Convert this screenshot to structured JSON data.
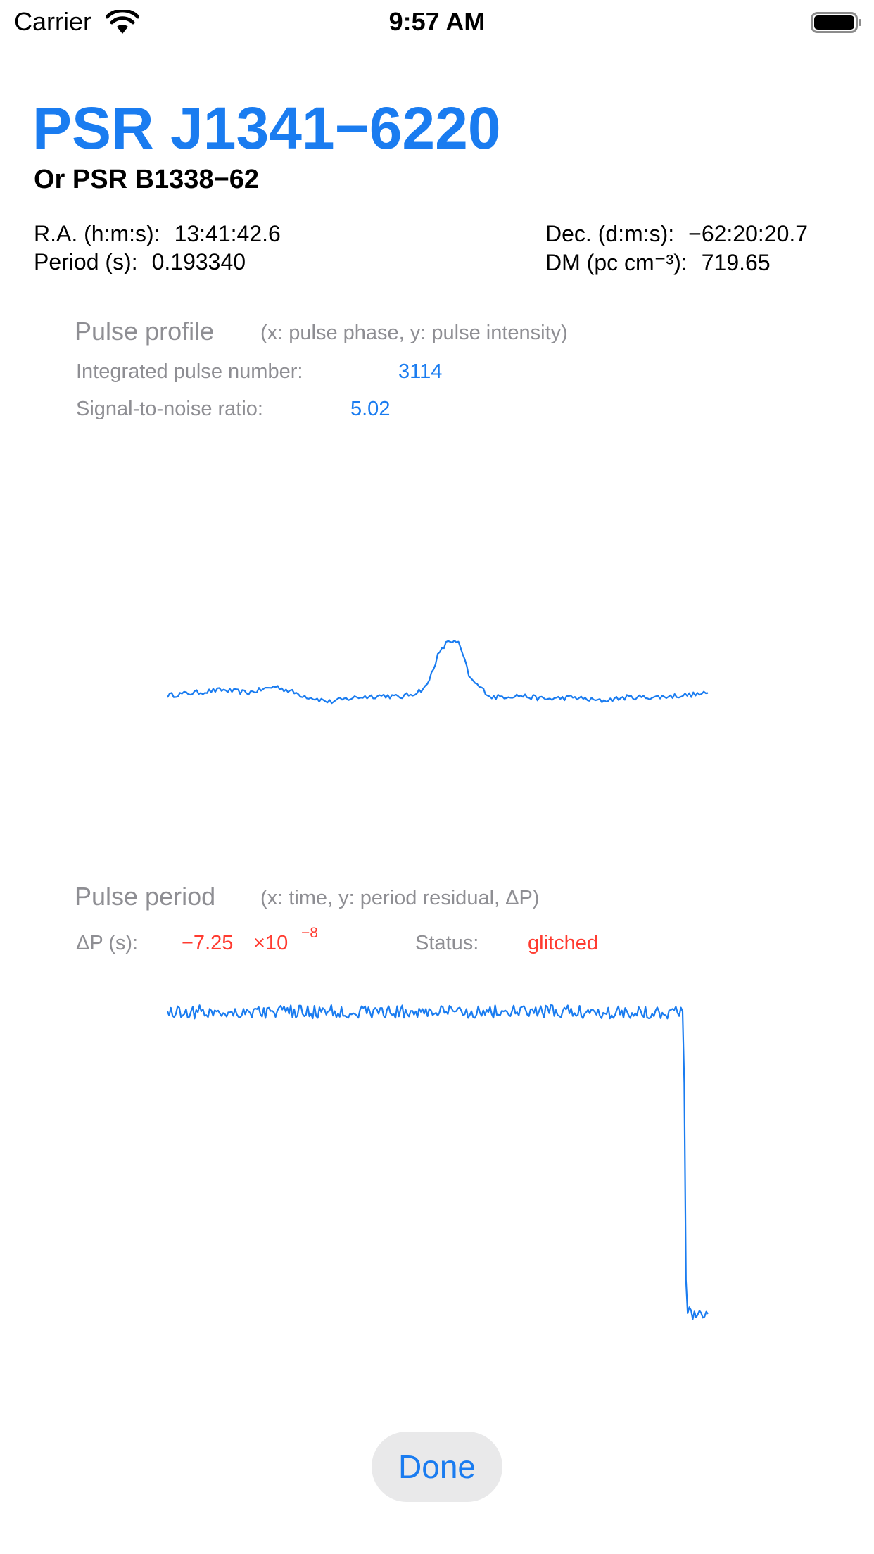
{
  "status_bar": {
    "carrier": "Carrier",
    "time": "9:57 AM",
    "wifi_icon": "wifi-icon",
    "battery_icon": "battery-full-icon"
  },
  "header": {
    "title": "PSR J1341−6220",
    "subtitle": "Or PSR B1338−62"
  },
  "info": {
    "ra_label": "R.A. (h:m:s):",
    "ra_value": "13:41:42.6",
    "period_label": "Period (s):",
    "period_value": "0.193340",
    "dec_label": "Dec. (d:m:s):",
    "dec_value": "−62:20:20.7",
    "dm_label": "DM (pc cm⁻³):",
    "dm_value": "719.65"
  },
  "pulse_profile": {
    "title": "Pulse profile",
    "hint": "(x: pulse phase, y: pulse intensity)",
    "integrated_label": "Integrated pulse number:",
    "integrated_value": "3114",
    "snr_label": "Signal-to-noise ratio:",
    "snr_value": "5.02"
  },
  "pulse_period": {
    "title": "Pulse period",
    "hint": "(x: time, y: period residual, ΔP)",
    "dp_label": "ΔP (s):",
    "dp_mantissa": "−7.25",
    "dp_times": "×10",
    "dp_exponent": "−8",
    "status_label": "Status:",
    "status_value": "glitched"
  },
  "done_label": "Done",
  "colors": {
    "accent": "#1a7cf0",
    "secondary_text": "#8e8e93",
    "alert": "#ff3b30",
    "button_bg": "#e9e9ea"
  },
  "chart_data": [
    {
      "type": "line",
      "description": "pulse profile waveform (pulse intensity vs pulse phase), axes unlabeled",
      "title": "",
      "xlabel": "",
      "ylabel": "",
      "x": [
        0.0,
        0.05,
        0.1,
        0.15,
        0.2,
        0.25,
        0.3,
        0.35,
        0.4,
        0.43,
        0.46,
        0.48,
        0.5,
        0.52,
        0.54,
        0.56,
        0.6,
        0.65,
        0.7,
        0.75,
        0.8,
        0.85,
        0.9,
        0.95,
        1.0
      ],
      "values": [
        0.02,
        0.05,
        0.08,
        0.05,
        0.12,
        0.02,
        -0.05,
        0.0,
        0.02,
        0.0,
        0.05,
        0.12,
        0.45,
        0.62,
        0.58,
        0.2,
        0.0,
        0.02,
        -0.02,
        0.0,
        -0.04,
        0.0,
        0.0,
        0.02,
        0.04
      ],
      "ylim": [
        -0.3,
        1.0
      ],
      "noise_amplitude": 0.06
    },
    {
      "type": "line",
      "description": "pulse period residual vs time, flat then sharp drop (glitch) near the end, axes unlabeled",
      "title": "",
      "xlabel": "",
      "ylabel": "",
      "x": [
        0.0,
        0.25,
        0.5,
        0.75,
        0.95,
        0.955,
        0.96,
        1.0
      ],
      "values": [
        0.0,
        0.0,
        0.0,
        0.0,
        0.0,
        0.0,
        -7.25,
        -7.25
      ],
      "ylim": [
        -7.5,
        0.3
      ],
      "noise_amplitude": 0.06
    }
  ]
}
